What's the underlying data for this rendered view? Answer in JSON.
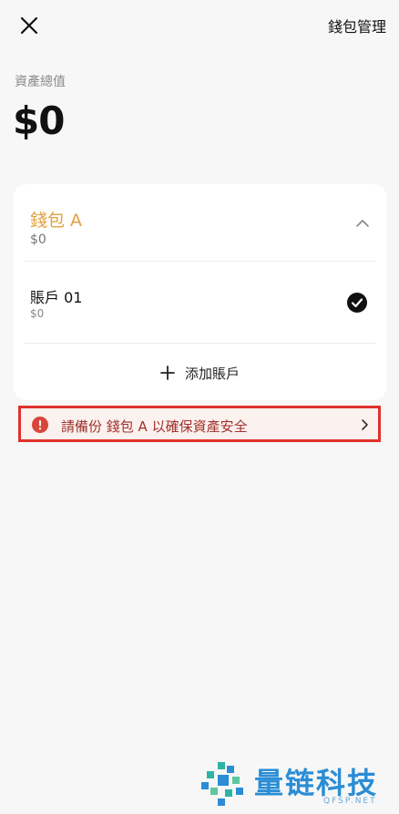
{
  "header": {
    "close_icon": "close-icon",
    "manage_label": "錢包管理"
  },
  "summary": {
    "label": "資產總值",
    "value": "$0"
  },
  "wallet": {
    "name": "錢包 A",
    "balance": "$0",
    "expanded": true,
    "accent_color": "#e2a03f",
    "accounts": [
      {
        "name": "賬戶 01",
        "balance": "$0",
        "selected": true
      }
    ],
    "add_account_label": "添加賬戶"
  },
  "backup_banner": {
    "text": "請備份 錢包 A 以確保資產安全",
    "highlight_color": "#e0312b",
    "text_color": "#a0312b"
  },
  "watermark": {
    "title": "量链科技",
    "subtitle": "QFSP.NET"
  }
}
